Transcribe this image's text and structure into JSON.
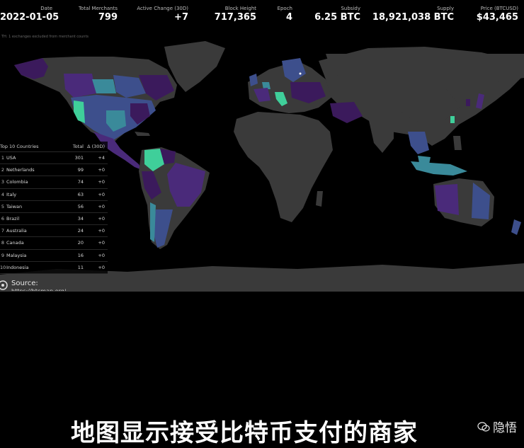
{
  "stats": [
    {
      "label": "Date",
      "value": "2022-01-05"
    },
    {
      "label": "Total Merchants",
      "value": "799"
    },
    {
      "label": "Active Change (30D)",
      "value": "+7"
    },
    {
      "label": "Block Height",
      "value": "717,365"
    },
    {
      "label": "Epoch",
      "value": "4"
    },
    {
      "label": "Subsidy",
      "value": "6.25 BTC"
    },
    {
      "label": "Supply",
      "value": "18,921,038 BTC"
    },
    {
      "label": "Price (BTCUSD)",
      "value": "$43,465"
    }
  ],
  "note": "TH: 1 exchanges excluded from merchant counts",
  "top10": {
    "headers": {
      "name": "Top 10 Countries",
      "total": "Total",
      "delta": "Δ (30D)"
    },
    "rows": [
      {
        "rank": "1",
        "name": "USA",
        "total": "301",
        "delta": "+4"
      },
      {
        "rank": "2",
        "name": "Netherlands",
        "total": "99",
        "delta": "+0"
      },
      {
        "rank": "3",
        "name": "Colombia",
        "total": "74",
        "delta": "+0"
      },
      {
        "rank": "4",
        "name": "Italy",
        "total": "63",
        "delta": "+0"
      },
      {
        "rank": "5",
        "name": "Taiwan",
        "total": "56",
        "delta": "+0"
      },
      {
        "rank": "6",
        "name": "Brazil",
        "total": "34",
        "delta": "+0"
      },
      {
        "rank": "7",
        "name": "Australia",
        "total": "24",
        "delta": "+0"
      },
      {
        "rank": "8",
        "name": "Canada",
        "total": "20",
        "delta": "+0"
      },
      {
        "rank": "9",
        "name": "Malaysia",
        "total": "16",
        "delta": "+0"
      },
      {
        "rank": "10",
        "name": "Indonesia",
        "total": "11",
        "delta": "+0"
      }
    ]
  },
  "source": {
    "label": "Source:",
    "url": "https://btcmap.org/"
  },
  "subtitle": "地图显示接受比特币支付的商家",
  "watermark": "隐悟",
  "colors": {
    "land": "#3a3a3a",
    "low": "#3b1a5c",
    "mid": "#3d4f8c",
    "high": "#3a8a9a",
    "top": "#3fcf9a"
  }
}
